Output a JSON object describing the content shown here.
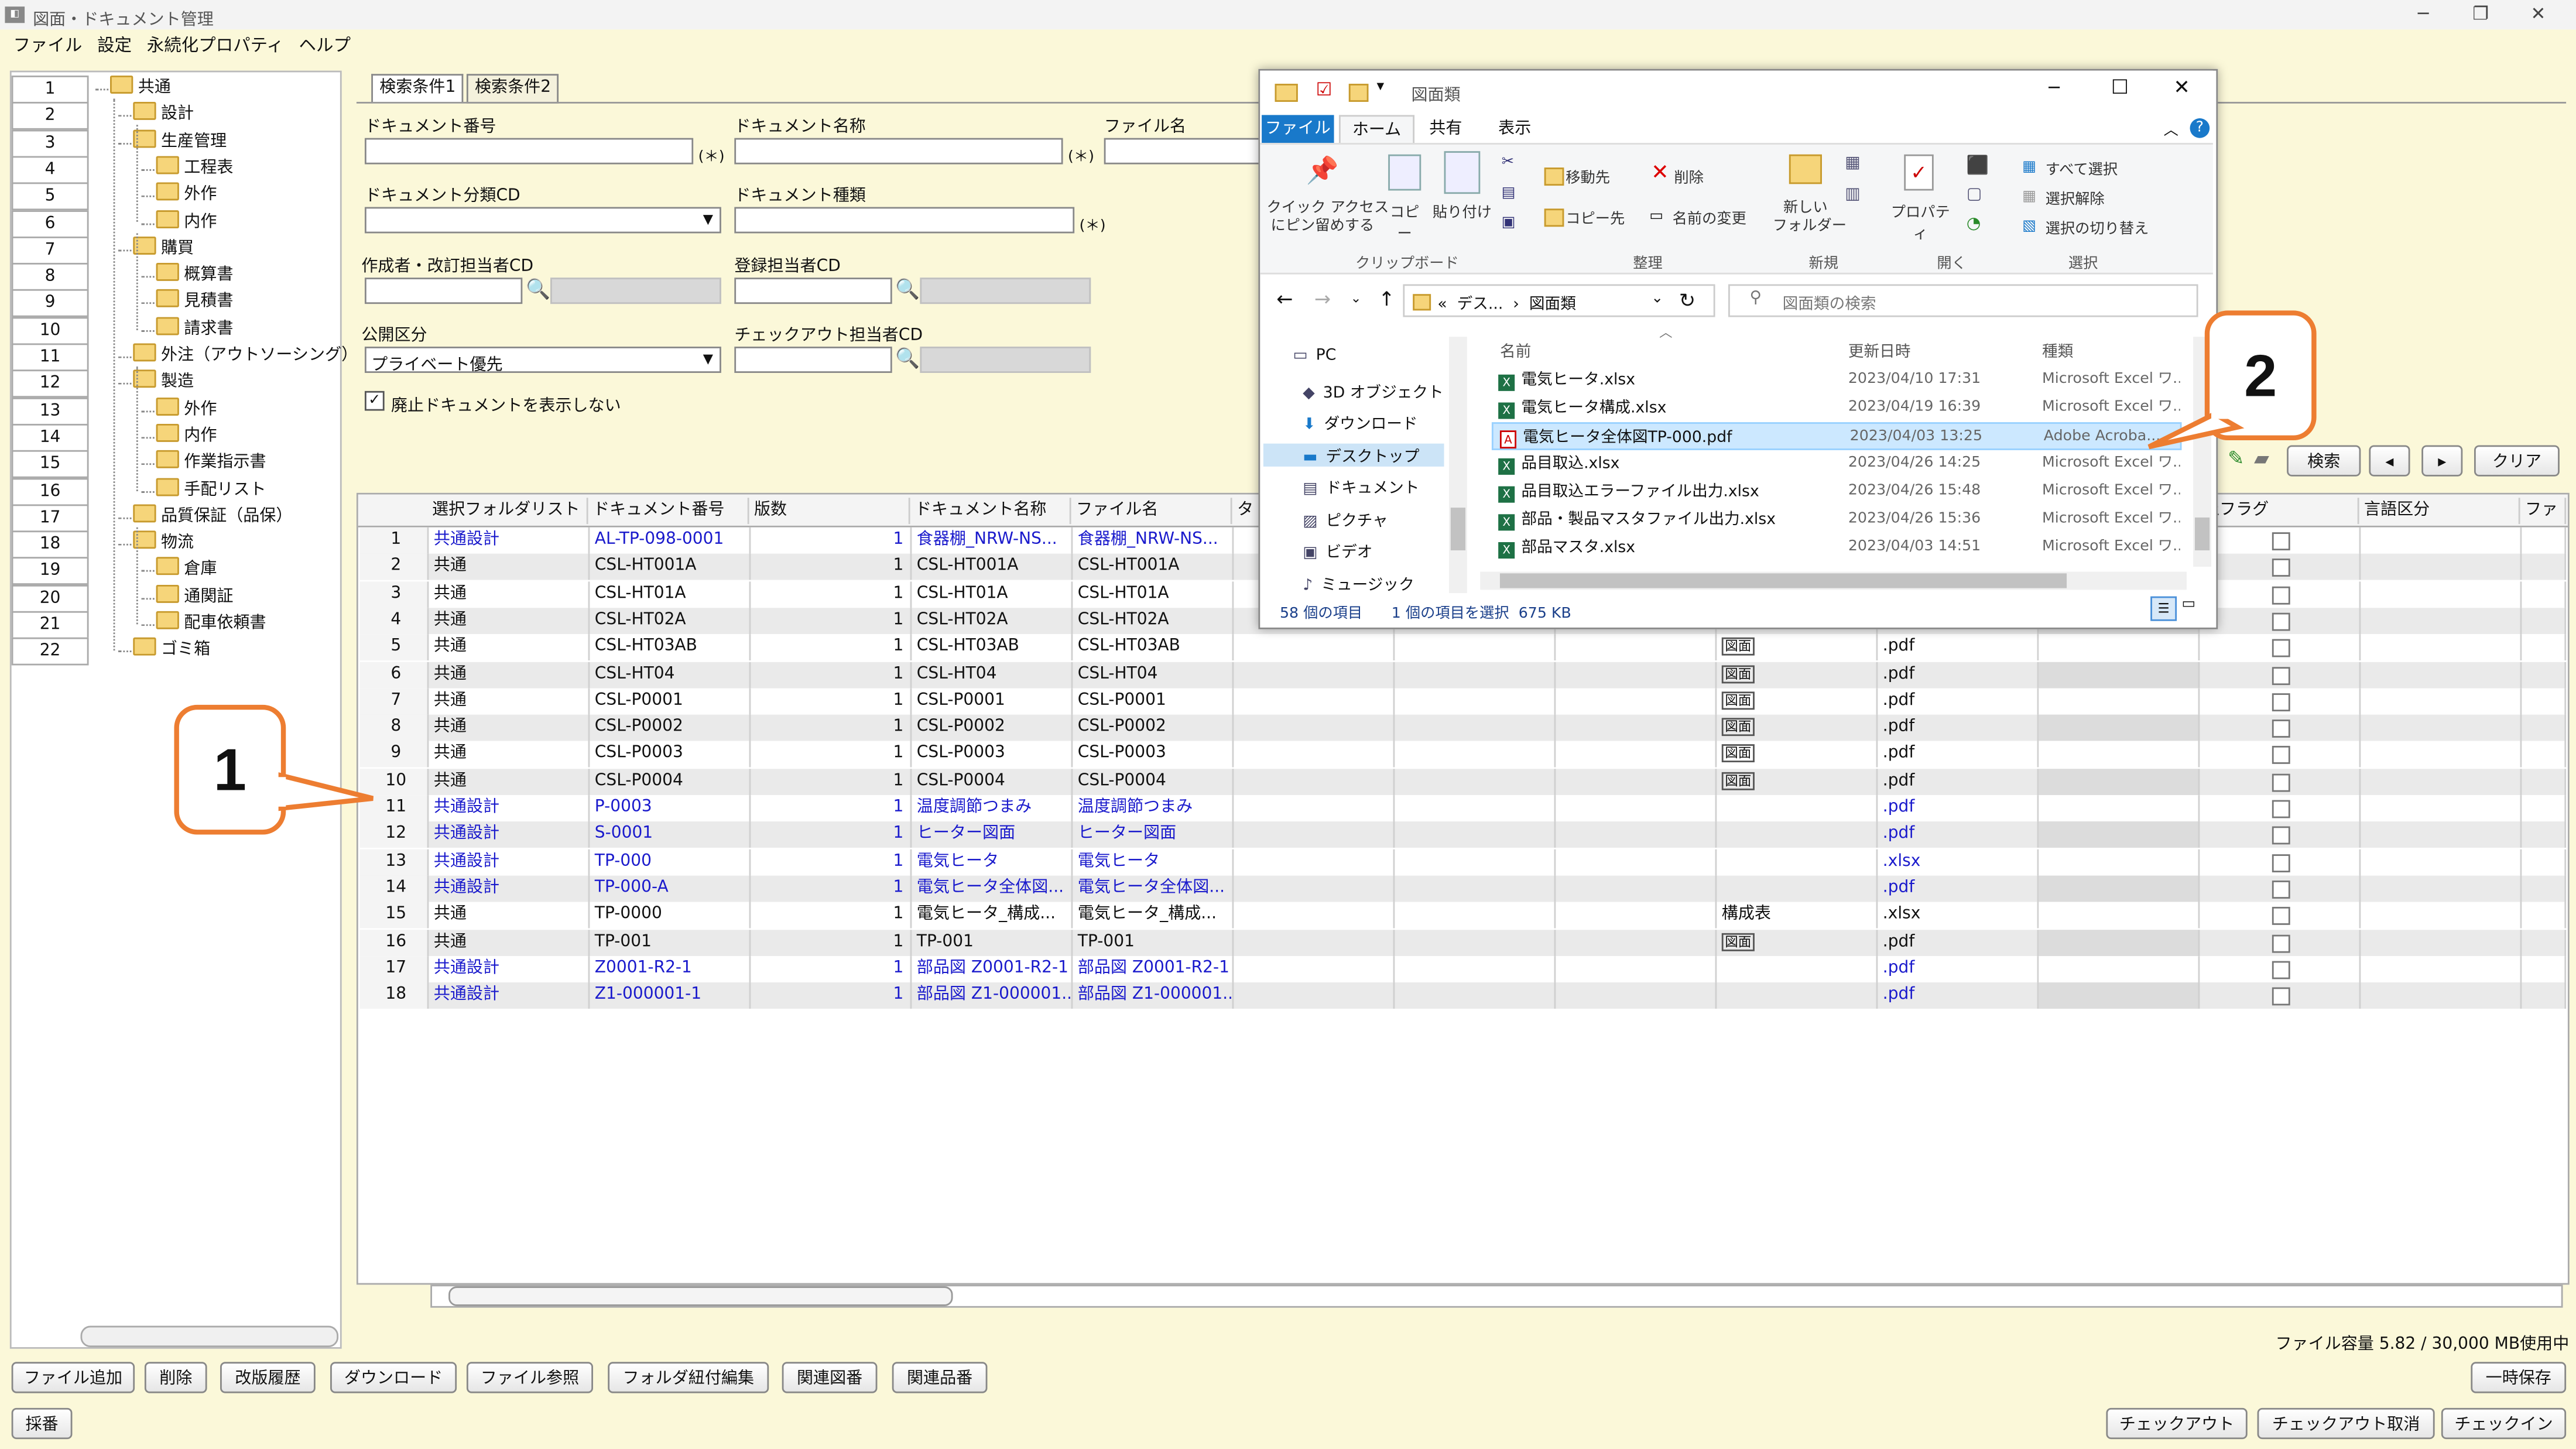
{
  "window": {
    "title": "図面・ドキュメント管理"
  },
  "menu": [
    "ファイル",
    "設定",
    "永続化プロパティ",
    "ヘルプ"
  ],
  "tree": {
    "numbers": [
      "1",
      "2",
      "3",
      "4",
      "5",
      "6",
      "7",
      "8",
      "9",
      "10",
      "11",
      "12",
      "13",
      "14",
      "15",
      "16",
      "17",
      "18",
      "19",
      "20",
      "21",
      "22"
    ],
    "nodes": [
      {
        "label": "共通",
        "level": 0
      },
      {
        "label": "設計",
        "level": 1
      },
      {
        "label": "生産管理",
        "level": 1
      },
      {
        "label": "工程表",
        "level": 2
      },
      {
        "label": "外作",
        "level": 2
      },
      {
        "label": "内作",
        "level": 2
      },
      {
        "label": "購買",
        "level": 1
      },
      {
        "label": "概算書",
        "level": 2
      },
      {
        "label": "見積書",
        "level": 2
      },
      {
        "label": "請求書",
        "level": 2
      },
      {
        "label": "外注（アウトソーシング）",
        "level": 1
      },
      {
        "label": "製造",
        "level": 1
      },
      {
        "label": "外作",
        "level": 2
      },
      {
        "label": "内作",
        "level": 2
      },
      {
        "label": "作業指示書",
        "level": 2
      },
      {
        "label": "手配リスト",
        "level": 2
      },
      {
        "label": "品質保証（品保）",
        "level": 1
      },
      {
        "label": "物流",
        "level": 1
      },
      {
        "label": "倉庫",
        "level": 2
      },
      {
        "label": "通関証",
        "level": 2
      },
      {
        "label": "配車依頼書",
        "level": 2
      },
      {
        "label": "ゴミ箱",
        "level": 1
      }
    ]
  },
  "tabs": [
    "検索条件1",
    "検索条件2"
  ],
  "form": {
    "doc_no_label": "ドキュメント番号",
    "doc_name_label": "ドキュメント名称",
    "file_name_label": "ファイル名",
    "doc_class_label": "ドキュメント分類CD",
    "doc_type_label": "ドキュメント種類",
    "creator_label": "作成者・改訂担当者CD",
    "registrant_label": "登録担当者CD",
    "public_label": "公開区分",
    "public_value": "プライベート優先",
    "checkout_label": "チェックアウト担当者CD",
    "hide_obsolete_label": "廃止ドキュメントを表示しない",
    "wild_note": "(＊)",
    "wild_note2": "(＊)"
  },
  "search_buttons": {
    "search": "検索",
    "prev": "◂",
    "next": "▸",
    "clear": "クリア"
  },
  "grid": {
    "headers": [
      "選択フォルダリスト",
      "ドキュメント番号",
      "版数",
      "ドキュメント名称",
      "ファイル名",
      "タ"
    ],
    "right_headers": [
      "止フラグ",
      "言語区分",
      "ファ"
    ],
    "rows": [
      {
        "n": "1",
        "folder": "共通設計",
        "doc": "AL-TP-098-0001",
        "ver": "1",
        "name": "食器棚_NRW-NS...",
        "file": "食器棚_NRW-NS...",
        "kind": "",
        "ext": "",
        "blue": true
      },
      {
        "n": "2",
        "folder": "共通",
        "doc": "CSL-HT001A",
        "ver": "1",
        "name": "CSL-HT001A",
        "file": "CSL-HT001A",
        "kind": "",
        "ext": "",
        "blue": false
      },
      {
        "n": "3",
        "folder": "共通",
        "doc": "CSL-HT01A",
        "ver": "1",
        "name": "CSL-HT01A",
        "file": "CSL-HT01A",
        "kind": "",
        "ext": "",
        "blue": false
      },
      {
        "n": "4",
        "folder": "共通",
        "doc": "CSL-HT02A",
        "ver": "1",
        "name": "CSL-HT02A",
        "file": "CSL-HT02A",
        "kind": "",
        "ext": "",
        "blue": false
      },
      {
        "n": "5",
        "folder": "共通",
        "doc": "CSL-HT03AB",
        "ver": "1",
        "name": "CSL-HT03AB",
        "file": "CSL-HT03AB",
        "kind": "図面",
        "ext": ".pdf",
        "blue": false
      },
      {
        "n": "6",
        "folder": "共通",
        "doc": "CSL-HT04",
        "ver": "1",
        "name": "CSL-HT04",
        "file": "CSL-HT04",
        "kind": "図面",
        "ext": ".pdf",
        "blue": false
      },
      {
        "n": "7",
        "folder": "共通",
        "doc": "CSL-P0001",
        "ver": "1",
        "name": "CSL-P0001",
        "file": "CSL-P0001",
        "kind": "図面",
        "ext": ".pdf",
        "blue": false
      },
      {
        "n": "8",
        "folder": "共通",
        "doc": "CSL-P0002",
        "ver": "1",
        "name": "CSL-P0002",
        "file": "CSL-P0002",
        "kind": "図面",
        "ext": ".pdf",
        "blue": false
      },
      {
        "n": "9",
        "folder": "共通",
        "doc": "CSL-P0003",
        "ver": "1",
        "name": "CSL-P0003",
        "file": "CSL-P0003",
        "kind": "図面",
        "ext": ".pdf",
        "blue": false
      },
      {
        "n": "10",
        "folder": "共通",
        "doc": "CSL-P0004",
        "ver": "1",
        "name": "CSL-P0004",
        "file": "CSL-P0004",
        "kind": "図面",
        "ext": ".pdf",
        "blue": false
      },
      {
        "n": "11",
        "folder": "共通設計",
        "doc": "P-0003",
        "ver": "1",
        "name": "温度調節つまみ",
        "file": "温度調節つまみ",
        "kind": "",
        "ext": ".pdf",
        "blue": true
      },
      {
        "n": "12",
        "folder": "共通設計",
        "doc": "S-0001",
        "ver": "1",
        "name": "ヒーター図面",
        "file": "ヒーター図面",
        "kind": "",
        "ext": ".pdf",
        "blue": true
      },
      {
        "n": "13",
        "folder": "共通設計",
        "doc": "TP-000",
        "ver": "1",
        "name": "電気ヒータ",
        "file": "電気ヒータ",
        "kind": "",
        "ext": ".xlsx",
        "blue": true
      },
      {
        "n": "14",
        "folder": "共通設計",
        "doc": "TP-000-A",
        "ver": "1",
        "name": "電気ヒータ全体図...",
        "file": "電気ヒータ全体図...",
        "kind": "",
        "ext": ".pdf",
        "blue": true
      },
      {
        "n": "15",
        "folder": "共通",
        "doc": "TP-0000",
        "ver": "1",
        "name": "電気ヒータ_構成...",
        "file": "電気ヒータ_構成...",
        "kind": "構成表",
        "ext": ".xlsx",
        "blue": false
      },
      {
        "n": "16",
        "folder": "共通",
        "doc": "TP-001",
        "ver": "1",
        "name": "TP-001",
        "file": "TP-001",
        "kind": "図面",
        "ext": ".pdf",
        "blue": false
      },
      {
        "n": "17",
        "folder": "共通設計",
        "doc": "Z0001-R2-1",
        "ver": "1",
        "name": "部品図 Z0001-R2-1",
        "file": "部品図 Z0001-R2-1",
        "kind": "",
        "ext": ".pdf",
        "blue": true
      },
      {
        "n": "18",
        "folder": "共通設計",
        "doc": "Z1-000001-1",
        "ver": "1",
        "name": "部品図 Z1-000001...",
        "file": "部品図 Z1-000001...",
        "kind": "",
        "ext": ".pdf",
        "blue": true
      }
    ]
  },
  "status": {
    "capacity": "ファイル容量 5.82 / 30,000 MB使用中"
  },
  "bottom_buttons": [
    "ファイル追加",
    "削除",
    "改版履歴",
    "ダウンロード",
    "ファイル参照",
    "フォルダ紐付編集",
    "関連図番",
    "関連品番"
  ],
  "temp_save": "一時保存",
  "saiban": "採番",
  "checkout_buttons": [
    "チェックアウト",
    "チェックアウト取消",
    "チェックイン"
  ],
  "explorer": {
    "title": "図面類",
    "ribbon_tabs": [
      "ファイル",
      "ホーム",
      "共有",
      "表示"
    ],
    "ribbon": {
      "pin": "クイック アクセス\nにピン留めする",
      "copy": "コピー",
      "paste": "貼り付け",
      "move_to": "移動先",
      "copy_to": "コピー先",
      "delete": "削除",
      "rename": "名前の変更",
      "new_folder": "新しい\nフォルダー",
      "properties": "プロパティ",
      "select_all": "すべて選択",
      "select_none": "選択解除",
      "invert": "選択の切り替え",
      "groups": [
        "クリップボード",
        "整理",
        "新規",
        "開く",
        "選択"
      ]
    },
    "breadcrumb": "«  デス...  ›  図面類",
    "search_placeholder": "図面類の検索",
    "nav": [
      "PC",
      "3D オブジェクト",
      "ダウンロード",
      "デスクトップ",
      "ドキュメント",
      "ピクチャ",
      "ビデオ",
      "ミュージック"
    ],
    "columns": [
      "名前",
      "更新日時",
      "種類"
    ],
    "files": [
      {
        "name": "電気ヒータ.xlsx",
        "date": "2023/04/10 17:31",
        "type": "Microsoft Excel ワ...",
        "icon": "excel"
      },
      {
        "name": "電気ヒータ構成.xlsx",
        "date": "2023/04/19 16:39",
        "type": "Microsoft Excel ワ...",
        "icon": "excel"
      },
      {
        "name": "電気ヒータ全体図TP-000.pdf",
        "date": "2023/04/03 13:25",
        "type": "Adobe Acroba...",
        "icon": "pdf",
        "selected": true
      },
      {
        "name": "品目取込.xlsx",
        "date": "2023/04/26 14:25",
        "type": "Microsoft Excel ワ...",
        "icon": "excel"
      },
      {
        "name": "品目取込エラーファイル出力.xlsx",
        "date": "2023/04/26 15:48",
        "type": "Microsoft Excel ワ...",
        "icon": "excel"
      },
      {
        "name": "部品・製品マスタファイル出力.xlsx",
        "date": "2023/04/26 15:36",
        "type": "Microsoft Excel ワ...",
        "icon": "excel"
      },
      {
        "name": "部品マスタ.xlsx",
        "date": "2023/04/03 14:51",
        "type": "Microsoft Excel ワ...",
        "icon": "excel"
      }
    ],
    "status_count": "58 個の項目",
    "status_selected": "1 個の項目を選択  675 KB"
  },
  "callouts": [
    "1",
    "2"
  ],
  "colors": {
    "accent_orange": "#ed7d31",
    "ribbon_blue": "#1979ca",
    "background": "#fbf8d9"
  }
}
